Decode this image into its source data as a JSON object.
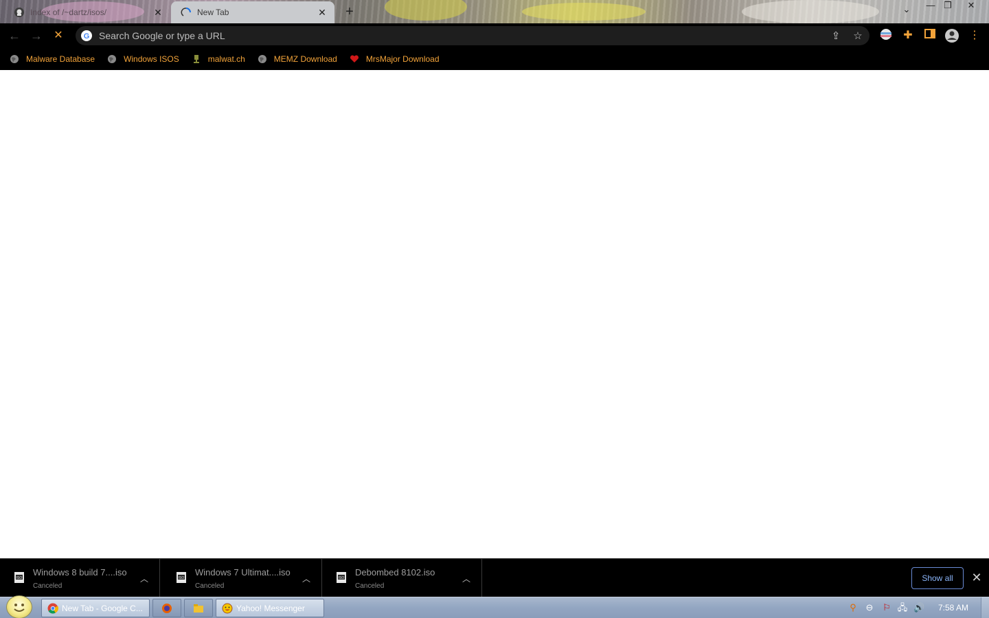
{
  "tabs": [
    {
      "title": "Index of /~dartz/isos/",
      "active": false
    },
    {
      "title": "New Tab",
      "active": true
    }
  ],
  "omnibox": {
    "placeholder": "Search Google or type a URL"
  },
  "bookmarks": [
    {
      "label": "Malware Database",
      "icon": "globe-icon"
    },
    {
      "label": "Windows ISOS",
      "icon": "globe-icon"
    },
    {
      "label": "malwat.ch",
      "icon": "trophy-icon"
    },
    {
      "label": "MEMZ Download",
      "icon": "globe-icon"
    },
    {
      "label": "MrsMajor Download",
      "icon": "heart-icon"
    }
  ],
  "downloads": [
    {
      "name": "Windows 8 build 7....iso",
      "status": "Canceled"
    },
    {
      "name": "Windows 7 Ultimat....iso",
      "status": "Canceled"
    },
    {
      "name": "Debombed 8102.iso",
      "status": "Canceled"
    }
  ],
  "shelf": {
    "show_all_label": "Show all"
  },
  "taskbar": {
    "items": [
      {
        "label": "New Tab - Google C...",
        "icon": "chrome-icon"
      },
      {
        "label": "",
        "icon": "firefox-icon"
      },
      {
        "label": "",
        "icon": "folder-icon"
      },
      {
        "label": "Yahoo! Messenger",
        "icon": "yahoo-smiley-icon"
      }
    ],
    "clock": "7:58 AM"
  },
  "colors": {
    "bookmark_text": "#f2a33a",
    "toolbar_bg": "#000000",
    "omnibox_bg": "#1e1e1e",
    "show_all_border": "#6a8bd6"
  }
}
